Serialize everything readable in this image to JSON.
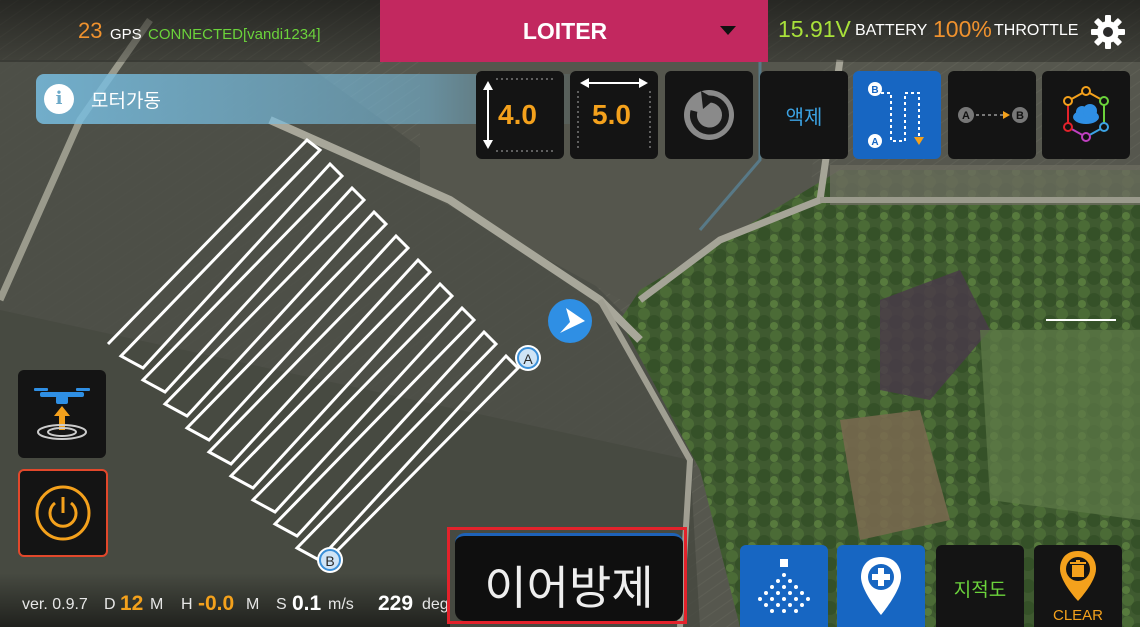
{
  "topbar": {
    "gps_count": "23",
    "gps_label": "GPS",
    "connection": "CONNECTED[vandi1234]",
    "mode": "LOITER",
    "voltage": "15.91V",
    "battery_label": "BATTERY",
    "throttle": "100%",
    "throttle_label": "THROTTLE",
    "settings_icon": "gear-icon"
  },
  "info": {
    "icon": "info-icon",
    "text": "모터가동"
  },
  "tools": {
    "height_value": "4.0",
    "width_value": "5.0",
    "rotate_icon": "rotate-icon",
    "liquid_label": "액제",
    "zigzag_icon": "zigzag-path-icon",
    "ab_icon": "a-to-b-icon",
    "cloud_icon": "cloud-network-icon"
  },
  "map": {
    "marker_a": "A",
    "marker_b": "B",
    "heading_icon": "heading-arrow-icon"
  },
  "status": {
    "version": "ver. 0.9.7",
    "d_label": "D",
    "d_value": "12",
    "d_unit": "M",
    "h_label": "H",
    "h_value": "-0.0",
    "h_unit": "M",
    "s_label": "S",
    "s_value": "0.1",
    "s_unit": "m/s",
    "deg_value": "229",
    "deg_unit": "deg"
  },
  "resume_label": "이어방제",
  "bottom_buttons": {
    "spray_icon": "spray-icon",
    "waypoint_icon": "add-waypoint-icon",
    "map_label": "지적도",
    "clear_label": "CLEAR"
  },
  "colors": {
    "accent_orange": "#f4a11c",
    "mode_bg": "#c2285f",
    "connected_green": "#6bd33b",
    "voltage_green": "#a8e13a",
    "button_blue": "#1766c2",
    "alert_red": "#e3222b"
  }
}
